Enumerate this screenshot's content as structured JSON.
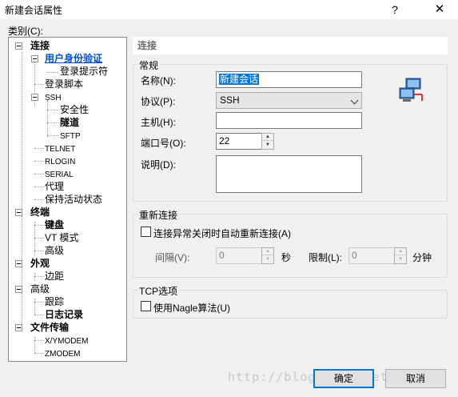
{
  "window": {
    "title": "新建会话属性",
    "help_label": "?",
    "close_label": "✕"
  },
  "category_label": "类别(C):",
  "tree": {
    "items": [
      {
        "label": "连接"
      },
      {
        "label": "用户身份验证"
      },
      {
        "label": "登录提示符"
      },
      {
        "label": "登录脚本"
      },
      {
        "label": "SSH"
      },
      {
        "label": "安全性"
      },
      {
        "label": "隧道"
      },
      {
        "label": "SFTP"
      },
      {
        "label": "TELNET"
      },
      {
        "label": "RLOGIN"
      },
      {
        "label": "SERIAL"
      },
      {
        "label": "代理"
      },
      {
        "label": "保持活动状态"
      },
      {
        "label": "终端"
      },
      {
        "label": "键盘"
      },
      {
        "label": "VT 模式"
      },
      {
        "label": "高级"
      },
      {
        "label": "外观"
      },
      {
        "label": "边距"
      },
      {
        "label": "高级"
      },
      {
        "label": "跟踪"
      },
      {
        "label": "日志记录"
      },
      {
        "label": "文件传输"
      },
      {
        "label": "X/YMODEM"
      },
      {
        "label": "ZMODEM"
      }
    ]
  },
  "panel": {
    "header": "连接",
    "general": {
      "title": "常规",
      "name_label": "名称(N):",
      "name_value": "新建会话",
      "protocol_label": "协议(P):",
      "protocol_value": "SSH",
      "host_label": "主机(H):",
      "host_value": "",
      "port_label": "端口号(O):",
      "port_value": "22",
      "desc_label": "说明(D):",
      "desc_value": ""
    },
    "reconnect": {
      "title": "重新连接",
      "auto_label": "连接异常关闭时自动重新连接(A)",
      "auto_checked": false,
      "interval_label": "间隔(V):",
      "interval_value": "0",
      "interval_unit": "秒",
      "limit_label": "限制(L):",
      "limit_value": "0",
      "limit_unit": "分钟"
    },
    "tcp": {
      "title": "TCP选项",
      "nagle_label": "使用Nagle算法(U)",
      "nagle_checked": false
    }
  },
  "buttons": {
    "ok": "确定",
    "cancel": "取消"
  },
  "watermark": "http://blog.csdn.net/gzgywo"
}
